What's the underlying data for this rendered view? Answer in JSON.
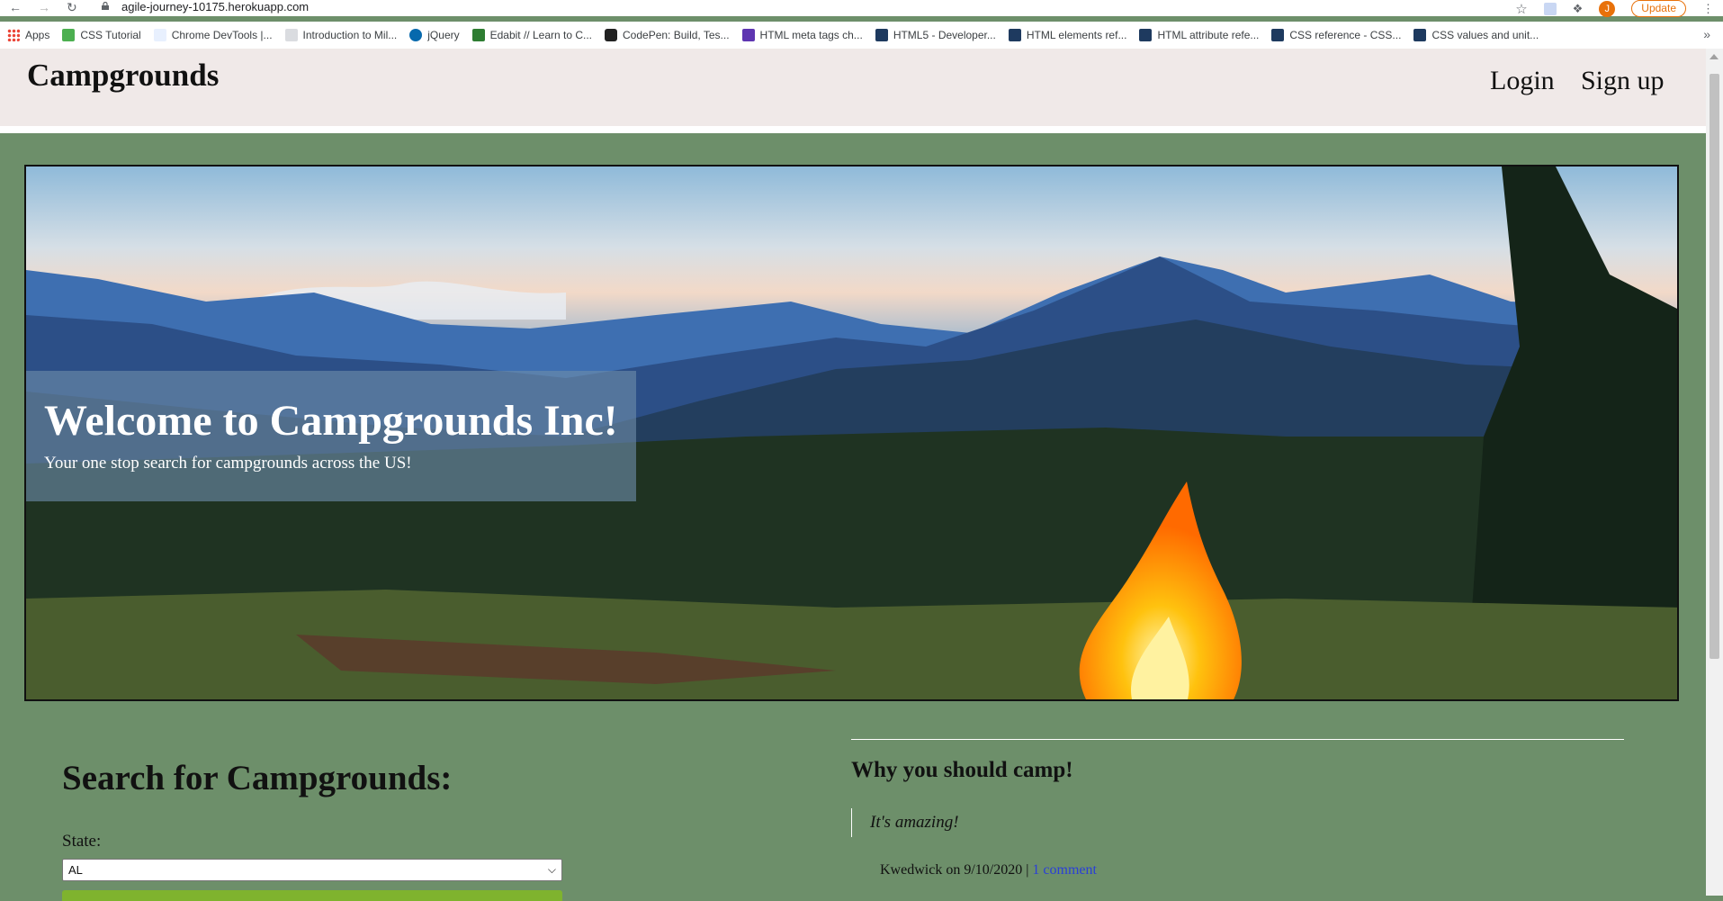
{
  "browser": {
    "url": "agile-journey-10175.herokuapp.com",
    "profile_initial": "J",
    "update_label": "Update",
    "bookmarks": [
      {
        "label": "Apps",
        "color": "#ea4335"
      },
      {
        "label": "CSS Tutorial",
        "color": "#4caf50"
      },
      {
        "label": "Chrome DevTools |...",
        "color": "#1a73e8"
      },
      {
        "label": "Introduction to Mil...",
        "color": "#5f6368"
      },
      {
        "label": "jQuery",
        "color": "#0769ad"
      },
      {
        "label": "Edabit // Learn to C...",
        "color": "#2e7d32"
      },
      {
        "label": "CodePen: Build, Tes...",
        "color": "#222222"
      },
      {
        "label": "HTML meta tags ch...",
        "color": "#5e35b1"
      },
      {
        "label": "HTML5 - Developer...",
        "color": "#1e3a5f"
      },
      {
        "label": "HTML elements ref...",
        "color": "#1e3a5f"
      },
      {
        "label": "HTML attribute refe...",
        "color": "#1e3a5f"
      },
      {
        "label": "CSS reference - CSS...",
        "color": "#1e3a5f"
      },
      {
        "label": "CSS values and unit...",
        "color": "#1e3a5f"
      }
    ]
  },
  "header": {
    "brand": "Campgrounds",
    "login": "Login",
    "signup": "Sign up"
  },
  "hero": {
    "title": "Welcome to Campgrounds Inc!",
    "subtitle": "Your one stop search for campgrounds across the US!"
  },
  "search": {
    "heading": "Search for Campgrounds:",
    "state_label": "State:",
    "state_value": "AL"
  },
  "why": {
    "heading": "Why you should camp!",
    "quote": "It's amazing!",
    "author": "Kwedwick",
    "on": "on",
    "date": "9/10/2020",
    "separator": "|",
    "comments": "1 comment"
  },
  "colors": {
    "page_bg": "#6d8f6a",
    "header_bg": "#f0e9e8",
    "search_button": "#7fb32e",
    "link": "#2a3fd8"
  }
}
